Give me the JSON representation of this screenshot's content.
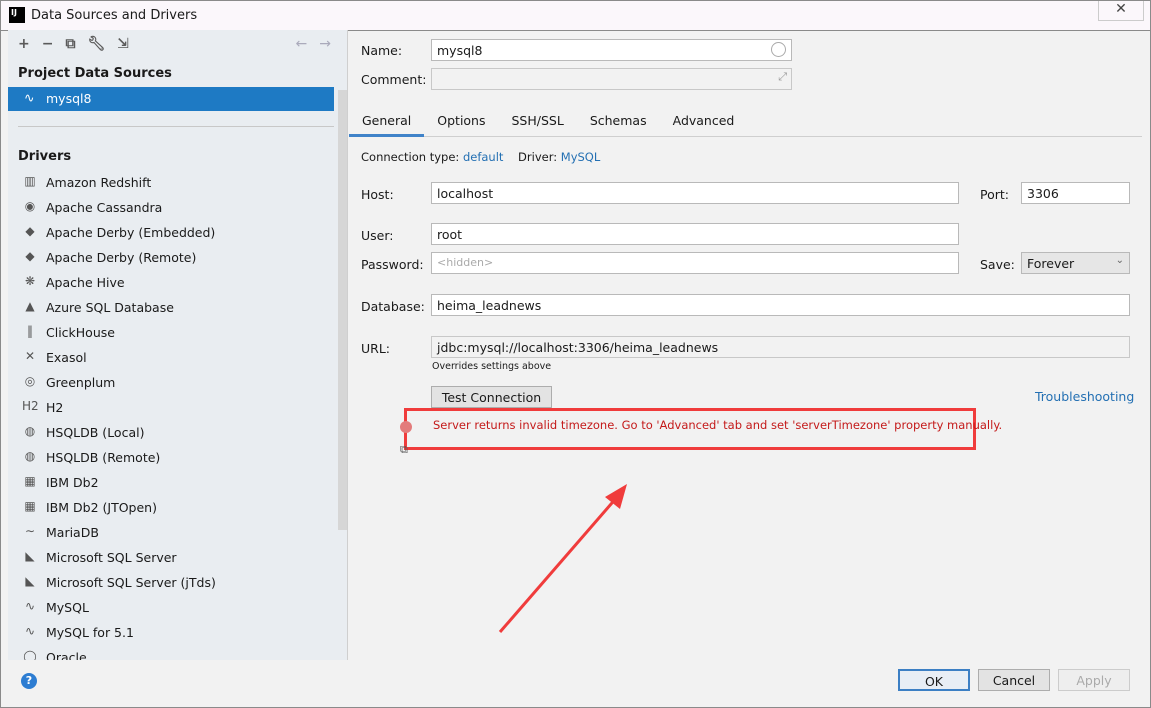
{
  "window": {
    "title": "Data Sources and Drivers",
    "logo": "IJ"
  },
  "toolbar": {
    "icons": [
      "plus-icon",
      "minus-icon",
      "copy-icon",
      "wrench-icon",
      "import-icon",
      "back-arrow-icon",
      "forward-arrow-icon"
    ]
  },
  "left": {
    "project_header": "Project Data Sources",
    "project_sources": [
      {
        "label": "mysql8",
        "icon": "mysql-dolphin-icon"
      }
    ],
    "drivers_header": "Drivers",
    "drivers": [
      {
        "label": "Amazon Redshift",
        "icon": "▥"
      },
      {
        "label": "Apache Cassandra",
        "icon": "◉"
      },
      {
        "label": "Apache Derby (Embedded)",
        "icon": "◆"
      },
      {
        "label": "Apache Derby (Remote)",
        "icon": "◆"
      },
      {
        "label": "Apache Hive",
        "icon": "❋"
      },
      {
        "label": "Azure SQL Database",
        "icon": "▲"
      },
      {
        "label": "ClickHouse",
        "icon": "‖"
      },
      {
        "label": "Exasol",
        "icon": "✕"
      },
      {
        "label": "Greenplum",
        "icon": "◎"
      },
      {
        "label": "H2",
        "icon": "H2"
      },
      {
        "label": "HSQLDB (Local)",
        "icon": "◍"
      },
      {
        "label": "HSQLDB (Remote)",
        "icon": "◍"
      },
      {
        "label": "IBM Db2",
        "icon": "▦"
      },
      {
        "label": "IBM Db2 (JTOpen)",
        "icon": "▦"
      },
      {
        "label": "MariaDB",
        "icon": "∼"
      },
      {
        "label": "Microsoft SQL Server",
        "icon": "◣"
      },
      {
        "label": "Microsoft SQL Server (jTds)",
        "icon": "◣"
      },
      {
        "label": "MySQL",
        "icon": "∿"
      },
      {
        "label": "MySQL for 5.1",
        "icon": "∿"
      },
      {
        "label": "Oracle",
        "icon": "◯"
      }
    ]
  },
  "form": {
    "name_label": "Name:",
    "name_value": "mysql8",
    "comment_label": "Comment:",
    "comment_value": "",
    "tabs": [
      "General",
      "Options",
      "SSH/SSL",
      "Schemas",
      "Advanced"
    ],
    "active_tab": "General",
    "connection_type_label": "Connection type:",
    "connection_type_value": "default",
    "driver_label": "Driver:",
    "driver_value": "MySQL",
    "host_label": "Host:",
    "host_value": "localhost",
    "port_label": "Port:",
    "port_value": "3306",
    "user_label": "User:",
    "user_value": "root",
    "password_label": "Password:",
    "password_placeholder": "<hidden>",
    "save_label": "Save:",
    "save_value": "Forever",
    "database_label": "Database:",
    "database_value": "heima_leadnews",
    "url_label": "URL:",
    "url_value": "jdbc:mysql://localhost:3306/heima_leadnews",
    "url_hint": "Overrides settings above",
    "test_button": "Test Connection",
    "troubleshooting": "Troubleshooting",
    "error_message": "Server returns invalid timezone. Go to 'Advanced' tab and set 'serverTimezone' property manually."
  },
  "footer": {
    "help": "?",
    "ok": "OK",
    "cancel": "Cancel",
    "apply": "Apply"
  },
  "colors": {
    "accent": "#1e7ac4",
    "error": "#c41a1a",
    "annotation": "#f03c3c"
  }
}
